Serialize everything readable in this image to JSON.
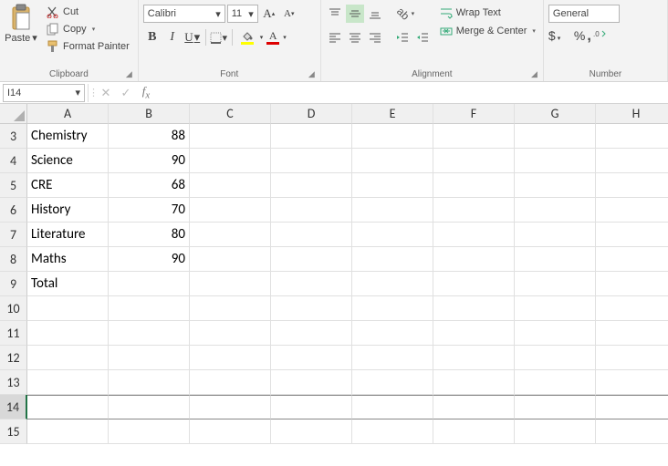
{
  "ribbon": {
    "clipboard": {
      "paste": "Paste",
      "cut": "Cut",
      "copy": "Copy",
      "format_painter": "Format Painter",
      "label": "Clipboard"
    },
    "font": {
      "name": "Calibri",
      "size": "11",
      "label": "Font"
    },
    "alignment": {
      "wrap": "Wrap Text",
      "merge": "Merge & Center",
      "label": "Alignment"
    },
    "number": {
      "format": "General",
      "label": "Number"
    }
  },
  "namebox": "I14",
  "columns": [
    "A",
    "B",
    "C",
    "D",
    "E",
    "F",
    "G",
    "H"
  ],
  "rows": [
    {
      "n": 3,
      "a": "Chemistry",
      "b": "88"
    },
    {
      "n": 4,
      "a": "Science",
      "b": "90"
    },
    {
      "n": 5,
      "a": "CRE",
      "b": "68"
    },
    {
      "n": 6,
      "a": "History",
      "b": "70"
    },
    {
      "n": 7,
      "a": "Literature",
      "b": "80"
    },
    {
      "n": 8,
      "a": "Maths",
      "b": "90"
    },
    {
      "n": 9,
      "a": "Total",
      "b": ""
    },
    {
      "n": 10,
      "a": "",
      "b": ""
    },
    {
      "n": 11,
      "a": "",
      "b": ""
    },
    {
      "n": 12,
      "a": "",
      "b": ""
    },
    {
      "n": 13,
      "a": "",
      "b": ""
    },
    {
      "n": 14,
      "a": "",
      "b": "",
      "sel": true
    },
    {
      "n": 15,
      "a": "",
      "b": ""
    }
  ]
}
